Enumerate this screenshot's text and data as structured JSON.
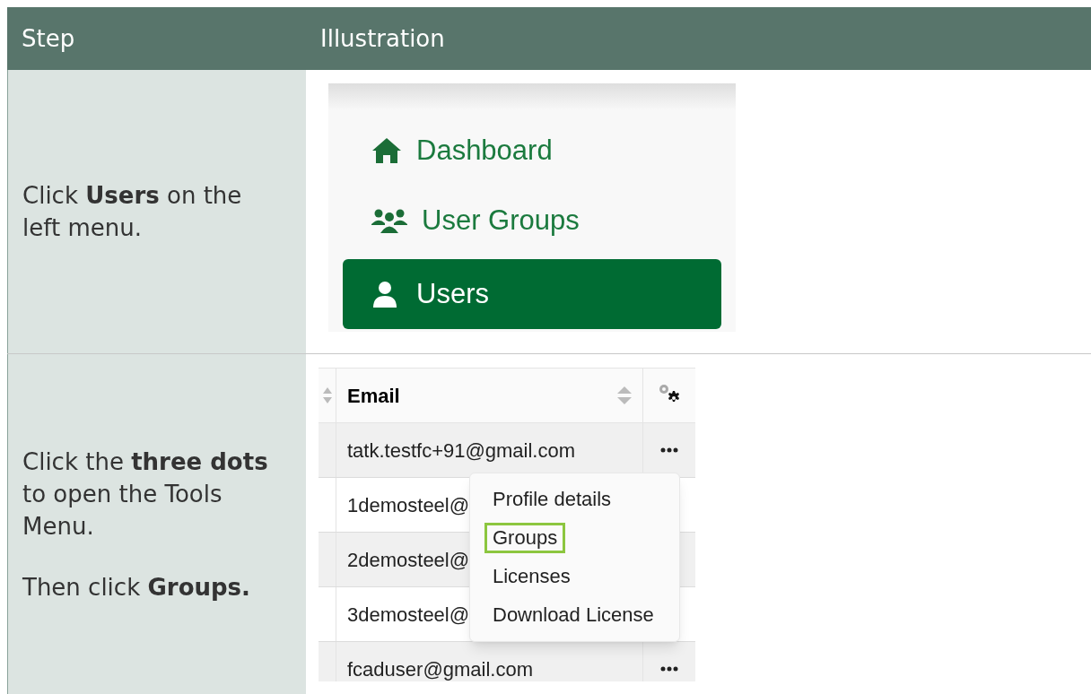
{
  "header": {
    "columns": [
      "Step",
      "Illustration"
    ]
  },
  "steps": [
    {
      "kind": "nav",
      "paragraphs": [
        "Click **Users** on the left menu."
      ],
      "nav_items": [
        {
          "label": "Dashboard",
          "selected": false
        },
        {
          "label": "User Groups",
          "selected": false
        },
        {
          "label": "Users",
          "selected": true
        }
      ]
    },
    {
      "kind": "table",
      "paragraphs": [
        "Click the **three dots** to open the Tools Menu.",
        "Then click **Groups.**"
      ],
      "table": {
        "columns": [
          "Email"
        ],
        "rows": [
          {
            "email": "tatk.testfc+91@gmail.com",
            "actions_visible": true
          },
          {
            "email": "1demosteel@",
            "actions_visible": false
          },
          {
            "email": "2demosteel@",
            "actions_visible": false
          },
          {
            "email": "3demosteel@",
            "actions_visible": false
          },
          {
            "email": "fcaduser@gmail.com",
            "actions_visible": true
          }
        ]
      },
      "menu": [
        {
          "label": "Profile details",
          "highlighted": false
        },
        {
          "label": "Groups",
          "highlighted": true
        },
        {
          "label": "Licenses",
          "highlighted": false
        },
        {
          "label": "Download License",
          "highlighted": false
        }
      ]
    }
  ]
}
